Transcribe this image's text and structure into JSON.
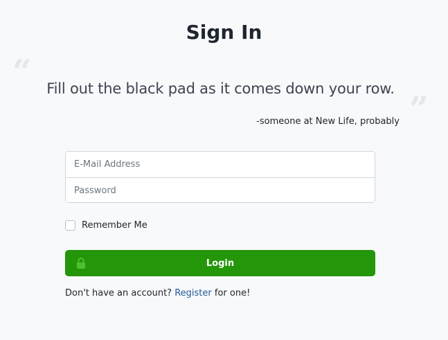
{
  "page": {
    "title": "Sign In"
  },
  "quote": {
    "open_mark": "“",
    "close_mark": "”",
    "text": "Fill out the black pad as it comes down your row.",
    "attribution": "-someone at New Life, probably"
  },
  "form": {
    "email_placeholder": "E-Mail Address",
    "email_value": "",
    "password_placeholder": "Password",
    "password_value": "",
    "remember_label": "Remember Me",
    "remember_checked": false,
    "login_label": "Login",
    "login_icon": "lock-icon"
  },
  "register": {
    "prefix": "Don't have an account?",
    "link_label": "Register",
    "suffix": "for one!"
  },
  "colors": {
    "accent_green": "#24960a",
    "link_blue": "#1f5a96",
    "background": "#f8f9fb"
  }
}
